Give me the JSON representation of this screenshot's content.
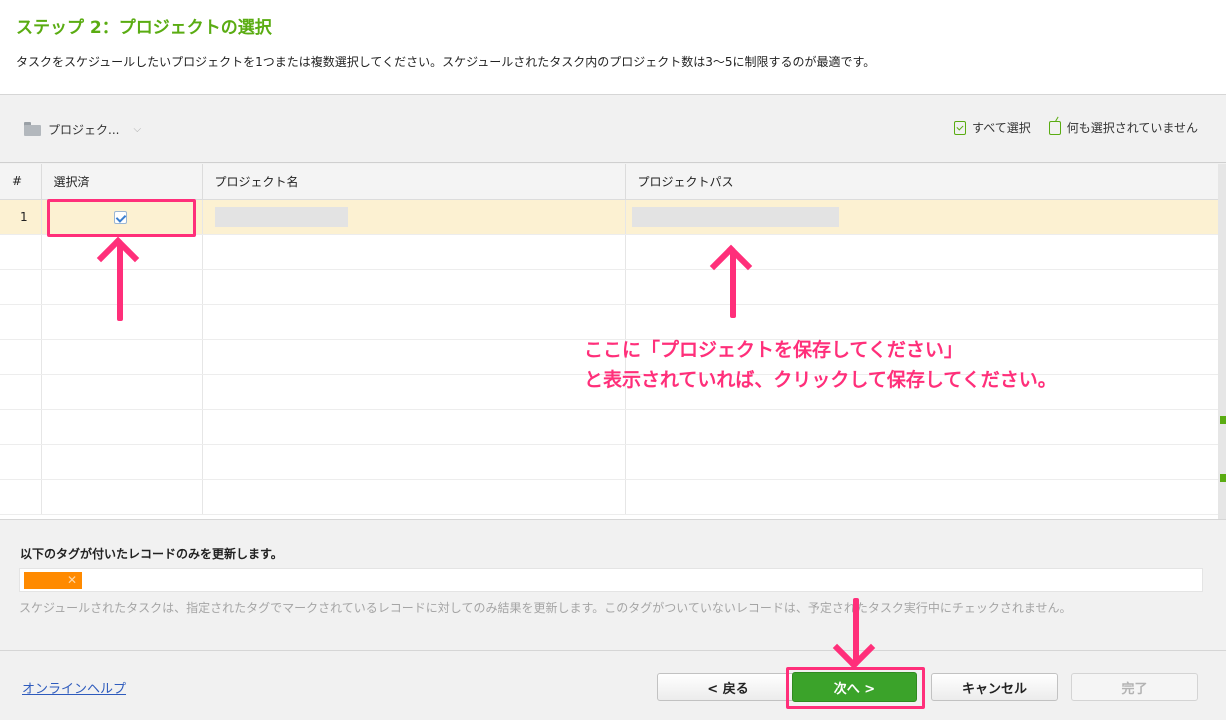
{
  "header": {
    "title": "ステップ 2：プロジェクトの選択",
    "description": "タスクをスケジュールしたいプロジェクトを1つまたは複数選択してください。スケジュールされたタスク内のプロジェクト数は3〜5に制限するのが最適です。"
  },
  "toolbar": {
    "project_dropdown": "プロジェク...",
    "select_all": "すべて選択",
    "select_none": "何も選択されていません"
  },
  "grid": {
    "columns": [
      "#",
      "選択済",
      "プロジェクト名",
      "プロジェクトパス"
    ],
    "rows": [
      {
        "num": "1",
        "checked": true,
        "name": "",
        "path": ""
      }
    ]
  },
  "tags": {
    "title": "以下のタグが付いたレコードのみを更新します。",
    "chip_color": "#ff8a00",
    "note": "スケジュールされたタスクは、指定されたタグでマークされているレコードに対してのみ結果を更新します。このタグがついていないレコードは、予定されたタスク実行中にチェックされません。"
  },
  "footer": {
    "help": "オンラインヘルプ",
    "back": "< 戻る",
    "next": "次へ >",
    "cancel": "キャンセル",
    "done": "完了"
  },
  "annotation": {
    "line1": "ここに「プロジェクトを保存してください」",
    "line2": "と表示されていれば、クリックして保存してください。",
    "color": "#ff2f7a"
  },
  "colors": {
    "accent": "#5aac12",
    "next_button": "#3ba32a",
    "selected_row": "#fcf1d2"
  }
}
